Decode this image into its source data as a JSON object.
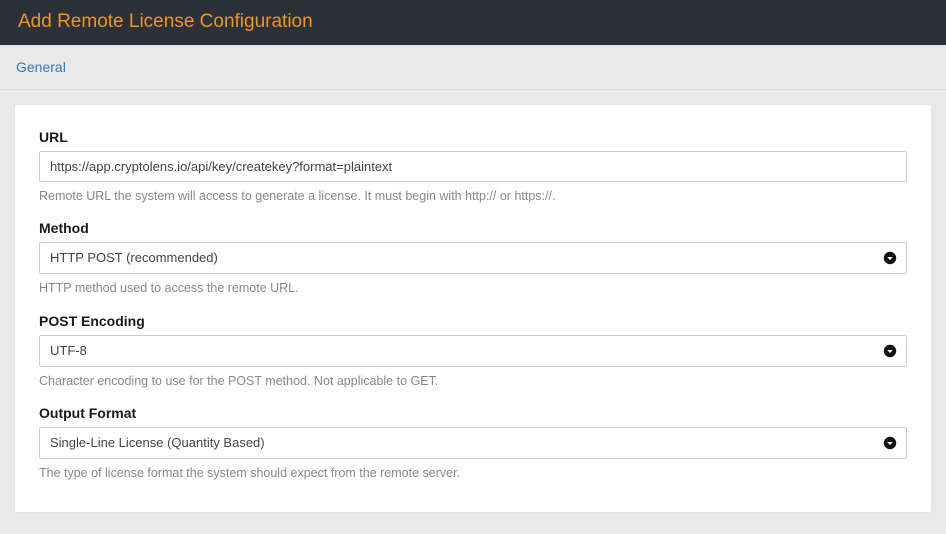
{
  "header": {
    "title": "Add Remote License Configuration"
  },
  "tabs": {
    "general": "General"
  },
  "form": {
    "url": {
      "label": "URL",
      "value": "https://app.cryptolens.io/api/key/createkey?format=plaintext",
      "help": "Remote URL the system will access to generate a license. It must begin with http:// or https://."
    },
    "method": {
      "label": "Method",
      "value": "HTTP POST (recommended)",
      "help": "HTTP method used to access the remote URL."
    },
    "postEncoding": {
      "label": "POST Encoding",
      "value": "UTF-8",
      "help": "Character encoding to use for the POST method. Not applicable to GET."
    },
    "outputFormat": {
      "label": "Output Format",
      "value": "Single-Line License (Quantity Based)",
      "help": "The type of license format the system should expect from the remote server."
    }
  }
}
